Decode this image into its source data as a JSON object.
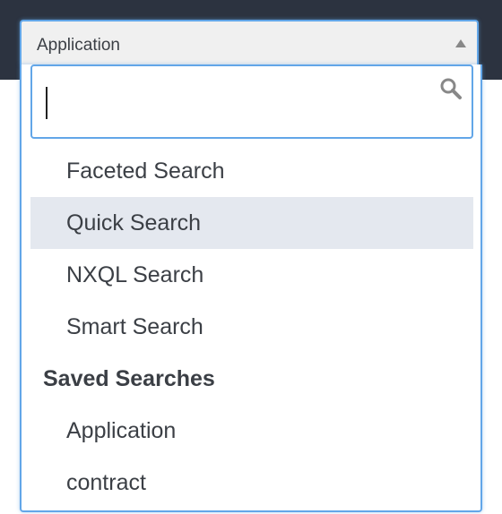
{
  "select": {
    "value": "Application"
  },
  "search": {
    "value": ""
  },
  "options": [
    {
      "label": "Faceted Search"
    },
    {
      "label": "Quick Search"
    },
    {
      "label": "NXQL Search"
    },
    {
      "label": "Smart Search"
    }
  ],
  "saved_group": {
    "label": "Saved Searches",
    "items": [
      {
        "label": "Application"
      },
      {
        "label": "contract"
      }
    ]
  },
  "icons": {
    "search": "search-icon",
    "arrow": "caret-up-icon"
  },
  "colors": {
    "accent": "#62a6e8",
    "topbar": "#2c3340",
    "highlight": "#e4e8ef"
  }
}
